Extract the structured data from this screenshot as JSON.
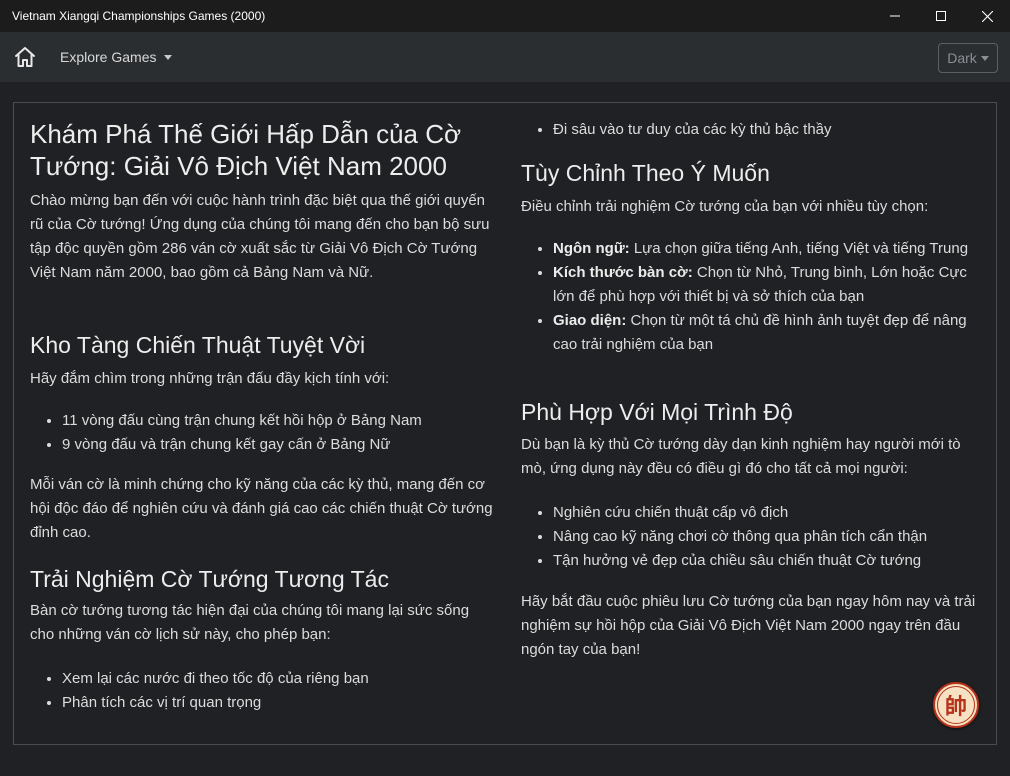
{
  "window": {
    "title": "Vietnam Xiangqi Championships Games (2000)"
  },
  "navbar": {
    "home_icon": "home-icon",
    "explore_label": "Explore Games",
    "theme_label": "Dark"
  },
  "left": {
    "h1": "Khám Phá Thế Giới Hấp Dẫn của Cờ Tướng: Giải Vô Địch Việt Nam 2000",
    "intro": "Chào mừng bạn đến với cuộc hành trình đặc biệt qua thế giới quyến rũ của Cờ tướng! Ứng dụng của chúng tôi mang đến cho bạn bộ sưu tập độc quyền gồm 286 ván cờ xuất sắc từ Giải Vô Địch Cờ Tướng Việt Nam năm 2000, bao gồm cả Bảng Nam và Nữ.",
    "h2_treasure": "Kho Tàng Chiến Thuật Tuyệt Vời",
    "treasure_intro": "Hãy đắm chìm trong những trận đấu đầy kịch tính với:",
    "treasure_items": [
      "11 vòng đấu cùng trận chung kết hồi hộp ở Bảng Nam",
      "9 vòng đấu và trận chung kết gay cấn ở Bảng Nữ"
    ],
    "treasure_outro": "Mỗi ván cờ là minh chứng cho kỹ năng của các kỳ thủ, mang đến cơ hội độc đáo để nghiên cứu và đánh giá cao các chiến thuật Cờ tướng đỉnh cao.",
    "h2_interactive": "Trải Nghiệm Cờ Tướng Tương Tác",
    "interactive_intro": "Bàn cờ tướng tương tác hiện đại của chúng tôi mang lại sức sống cho những ván cờ lịch sử này, cho phép bạn:",
    "interactive_items": [
      "Xem lại các nước đi theo tốc độ của riêng bạn",
      "Phân tích các vị trí quan trọng"
    ]
  },
  "right": {
    "top_item": "Đi sâu vào tư duy của các kỳ thủ bậc thầy",
    "h2_custom": "Tùy Chỉnh Theo Ý Muốn",
    "custom_intro": "Điều chỉnh trải nghiệm Cờ tướng của bạn với nhiều tùy chọn:",
    "custom_items": [
      {
        "label": "Ngôn ngữ:",
        "text": " Lựa chọn giữa tiếng Anh, tiếng Việt và tiếng Trung"
      },
      {
        "label": "Kích thước bàn cờ:",
        "text": " Chọn từ Nhỏ, Trung bình, Lớn hoặc Cực lớn để phù hợp với thiết bị và sở thích của bạn"
      },
      {
        "label": "Giao diện:",
        "text": " Chọn từ một tá chủ đề hình ảnh tuyệt đẹp để nâng cao trải nghiệm của bạn"
      }
    ],
    "h2_levels": "Phù Hợp Với Mọi Trình Độ",
    "levels_intro": "Dù bạn là kỳ thủ Cờ tướng dày dạn kinh nghiệm hay người mới tò mò, ứng dụng này đều có điều gì đó cho tất cả mọi người:",
    "levels_items": [
      "Nghiên cứu chiến thuật cấp vô địch",
      "Nâng cao kỹ năng chơi cờ thông qua phân tích cẩn thận",
      "Tận hưởng vẻ đẹp của chiều sâu chiến thuật Cờ tướng"
    ],
    "closing": "Hãy bắt đầu cuộc phiêu lưu Cờ tướng của bạn ngay hôm nay và trải nghiệm sự hồi hộp của Giải Vô Địch Việt Nam 2000 ngay trên đầu ngón tay của bạn!"
  },
  "seal": {
    "glyph": "帥",
    "icon": "general-piece-icon"
  }
}
